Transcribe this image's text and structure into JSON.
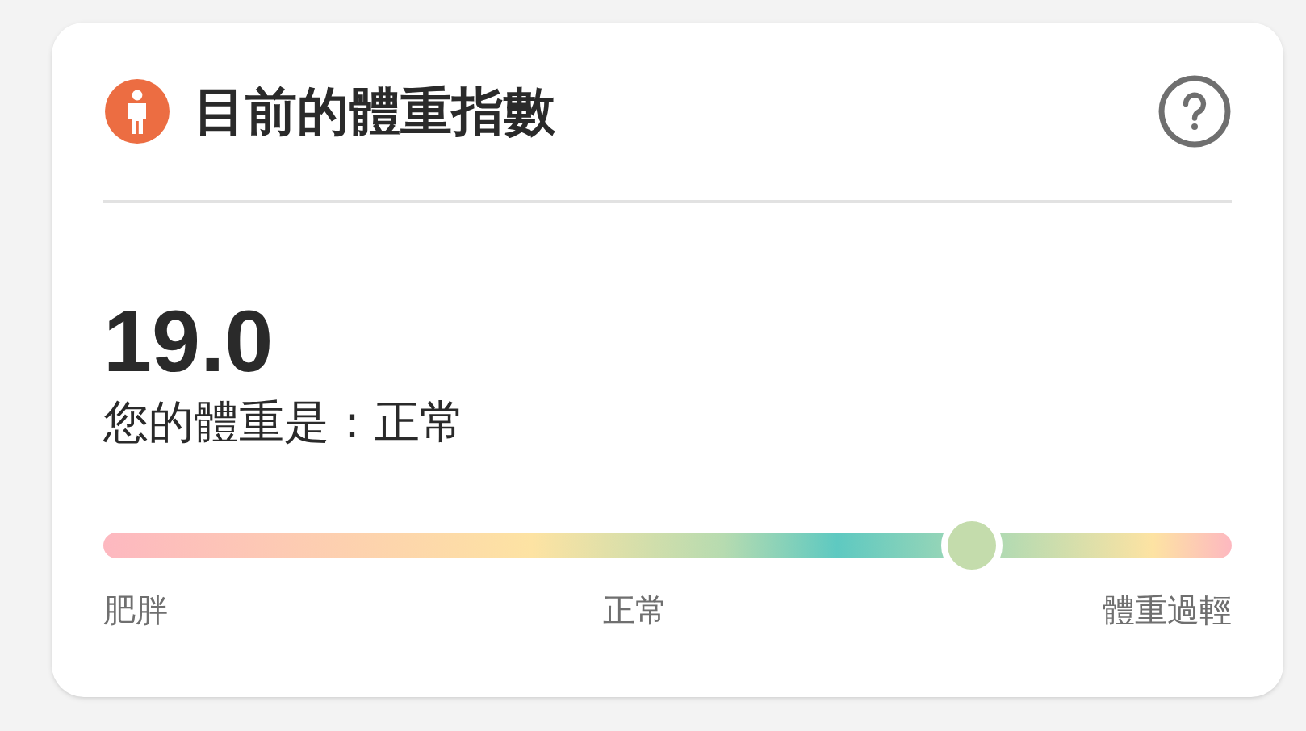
{
  "card": {
    "title": "目前的體重指數",
    "value": "19.0",
    "status_text": "您的體重是：正常",
    "scale": {
      "level": 0.77,
      "labels": [
        "肥胖",
        "正常",
        "體重過輕"
      ]
    }
  }
}
